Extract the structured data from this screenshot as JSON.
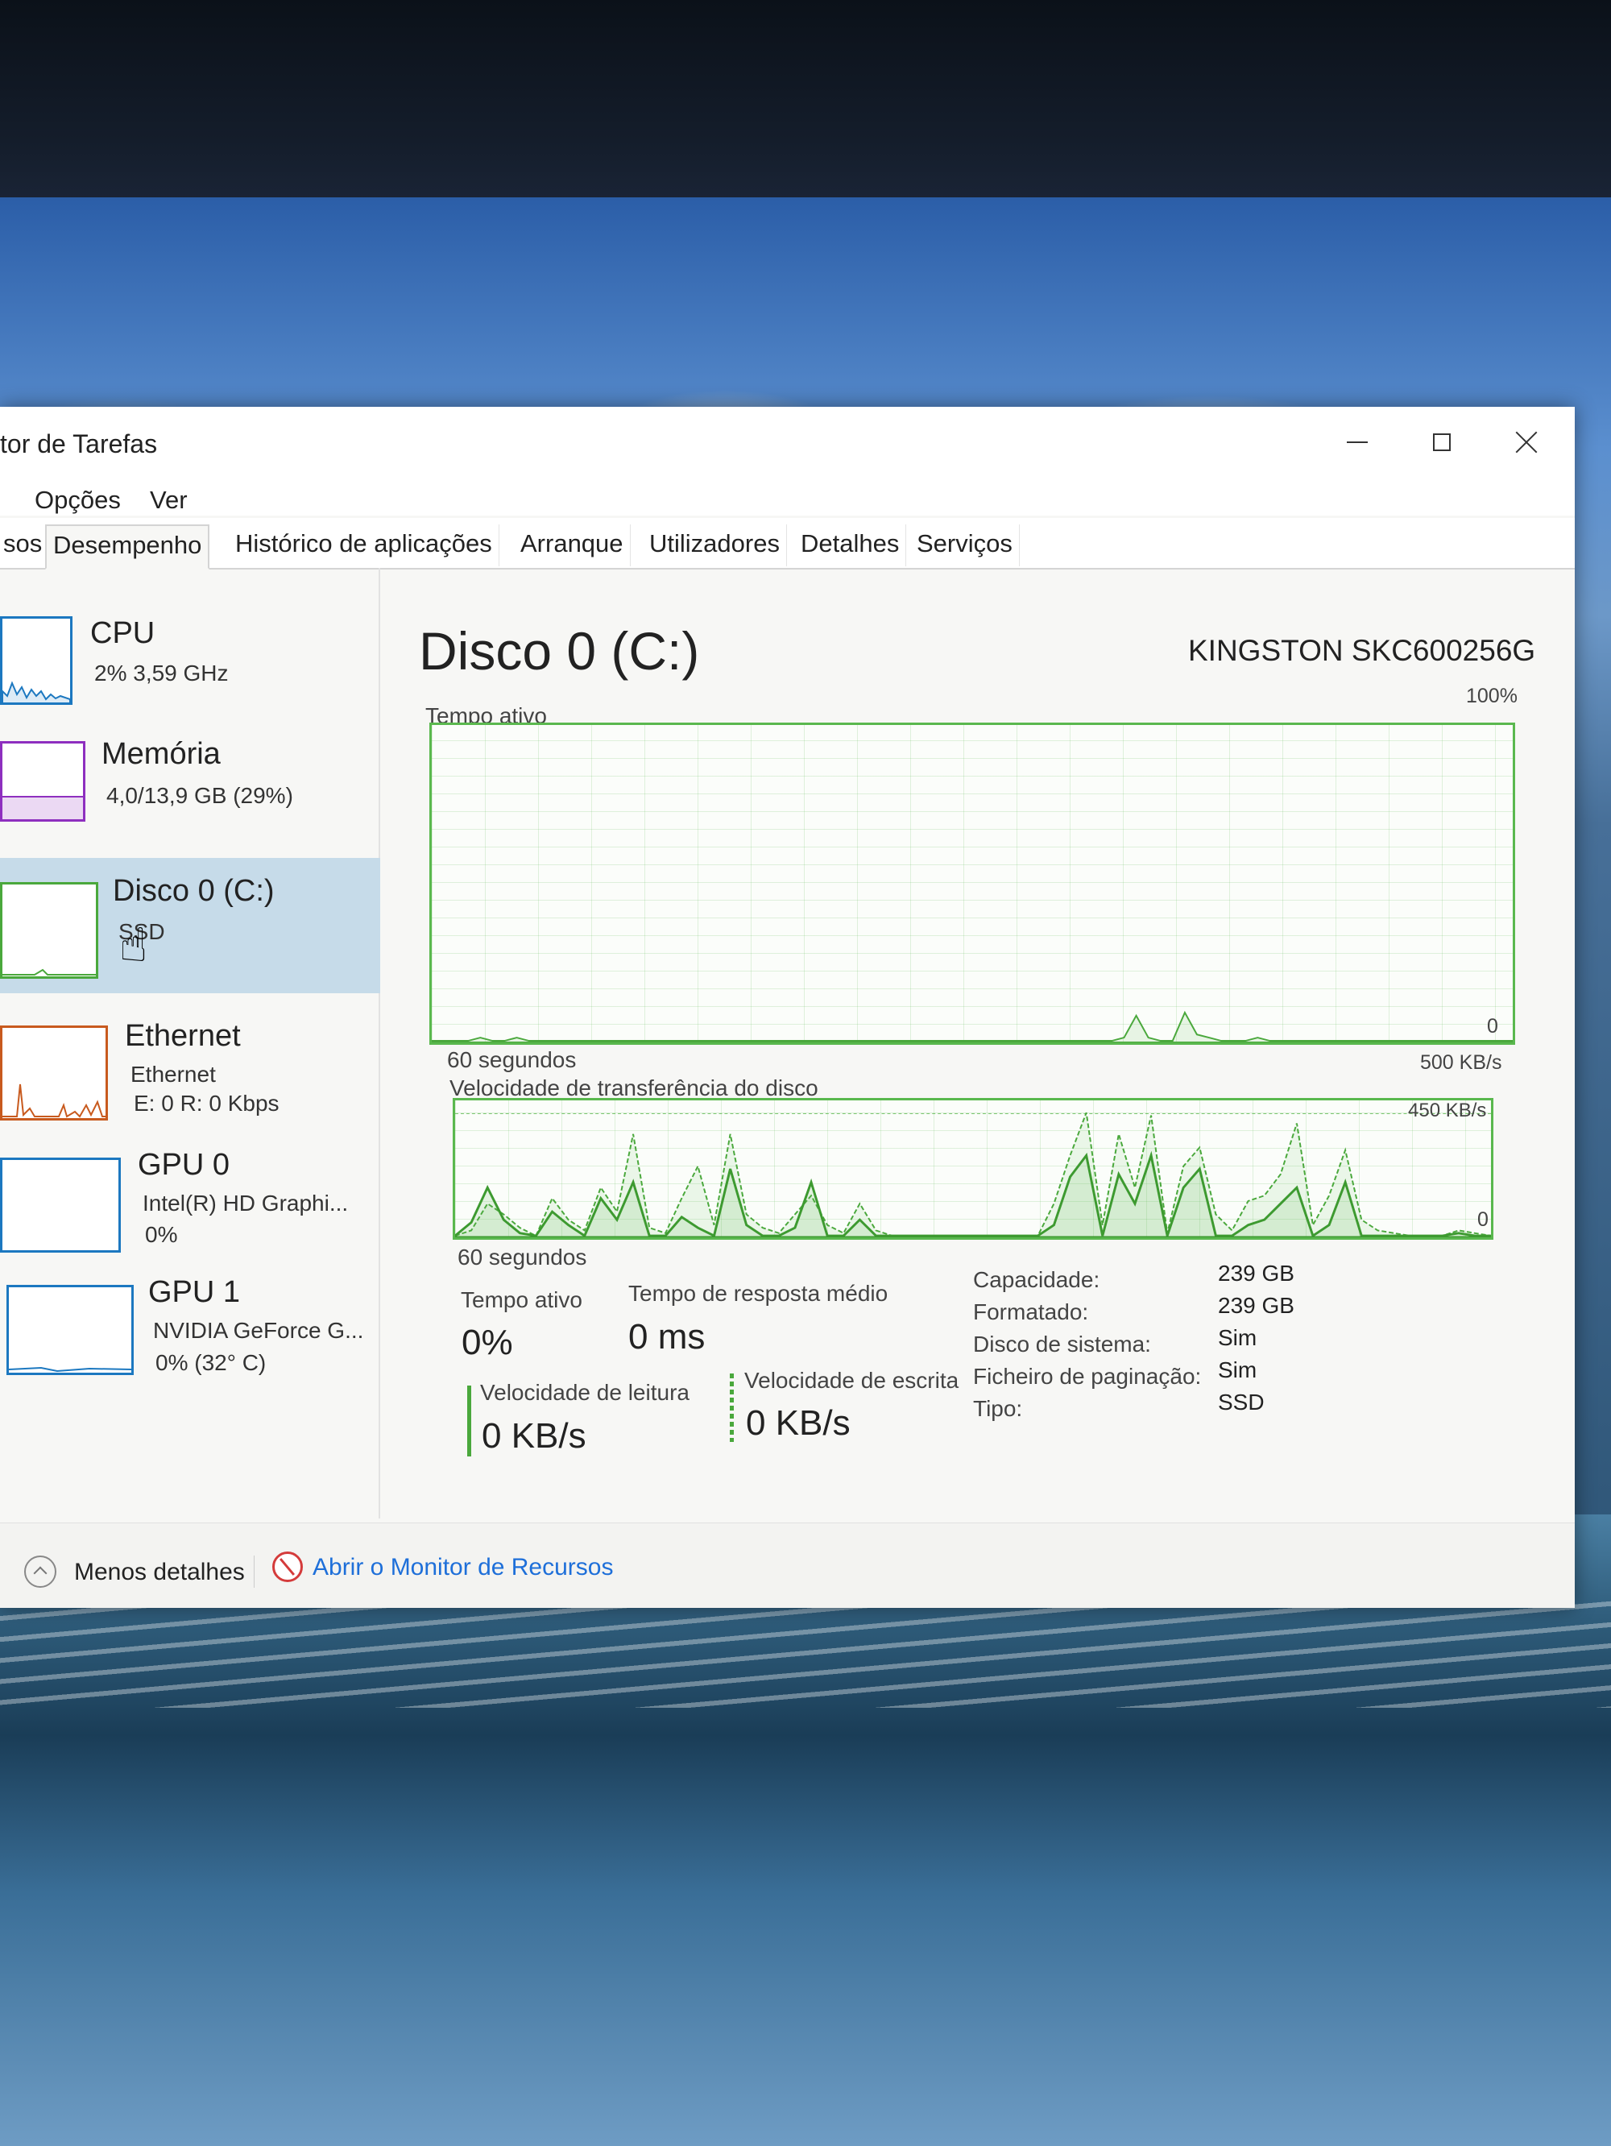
{
  "window": {
    "title": "tor de Tarefas",
    "minimize_label": "",
    "maximize_label": "",
    "close_label": ""
  },
  "menu": {
    "options": "Opções",
    "view": "Ver"
  },
  "tabs": [
    {
      "label": "sos",
      "active": false
    },
    {
      "label": "Desempenho",
      "active": true
    },
    {
      "label": "Histórico de aplicações",
      "active": false
    },
    {
      "label": "Arranque",
      "active": false
    },
    {
      "label": "Utilizadores",
      "active": false
    },
    {
      "label": "Detalhes",
      "active": false
    },
    {
      "label": "Serviços",
      "active": false
    }
  ],
  "sidebar": {
    "items": [
      {
        "title": "CPU",
        "line1": "2% 3,59 GHz",
        "line2": "",
        "color": "#1c78c0"
      },
      {
        "title": "Memória",
        "line1": "4,0/13,9 GB (29%)",
        "line2": "",
        "color": "#8e2fbf"
      },
      {
        "title": "Disco 0 (C:)",
        "line1": "SSD",
        "line2": "",
        "color": "#4aa83c",
        "selected": true
      },
      {
        "title": "Ethernet",
        "line1": "Ethernet",
        "line2": "E: 0 R: 0 Kbps",
        "color": "#c85a1e"
      },
      {
        "title": "GPU 0",
        "line1": "Intel(R) HD Graphi...",
        "line2": "0%",
        "color": "#1c78c0"
      },
      {
        "title": "GPU 1",
        "line1": "NVIDIA GeForce G...",
        "line2": "0% (32° C)",
        "color": "#1c78c0"
      }
    ]
  },
  "main": {
    "title": "Disco 0 (C:)",
    "model": "KINGSTON SKC600256G",
    "active_chart": {
      "label": "Tempo ativo",
      "max_label": "100%",
      "min_label": "0",
      "time_label": "60 segundos"
    },
    "transfer_chart": {
      "label": "Velocidade de transferência do disco",
      "max_label": "500 KB/s",
      "ref_label": "450 KB/s",
      "min_label": "0",
      "time_label": "60 segundos"
    },
    "stats": {
      "active_time_label": "Tempo ativo",
      "active_time_value": "0%",
      "response_label": "Tempo de resposta médio",
      "response_value": "0 ms",
      "read_label": "Velocidade de leitura",
      "read_value": "0 KB/s",
      "write_label": "Velocidade de escrita",
      "write_value": "0 KB/s"
    },
    "props": [
      {
        "key": "Capacidade:",
        "value": "239 GB"
      },
      {
        "key": "Formatado:",
        "value": "239 GB"
      },
      {
        "key": "Disco de sistema:",
        "value": "Sim"
      },
      {
        "key": "Ficheiro de paginação:",
        "value": "Sim"
      },
      {
        "key": "Tipo:",
        "value": "SSD"
      }
    ]
  },
  "footer": {
    "less_details": "Menos detalhes",
    "resource_monitor": "Abrir o Monitor de Recursos"
  },
  "series": {
    "active_time": [
      0,
      0,
      0,
      0,
      1,
      0,
      0,
      1,
      0,
      0,
      0,
      0,
      0,
      0,
      0,
      0,
      0,
      0,
      0,
      0,
      0,
      0,
      0,
      0,
      0,
      0,
      0,
      0,
      0,
      0,
      0,
      0,
      0,
      0,
      0,
      0,
      0,
      0,
      0,
      0,
      0,
      0,
      0,
      0,
      0,
      0,
      0,
      0,
      0,
      0,
      0,
      0,
      0,
      0,
      0,
      0,
      0,
      1,
      8,
      1,
      0,
      0,
      9,
      2,
      1,
      0,
      0,
      0,
      1,
      0,
      0,
      0,
      0,
      0,
      0,
      0,
      0,
      0,
      0,
      0,
      0,
      0,
      0,
      0,
      0,
      0,
      0,
      0,
      0,
      0
    ],
    "transfer_read": [
      0,
      50,
      180,
      60,
      10,
      0,
      90,
      40,
      0,
      140,
      60,
      200,
      0,
      0,
      70,
      30,
      0,
      250,
      40,
      0,
      0,
      30,
      200,
      0,
      0,
      60,
      0,
      0,
      0,
      0,
      0,
      0,
      0,
      0,
      0,
      0,
      0,
      40,
      220,
      300,
      0,
      230,
      120,
      300,
      0,
      180,
      250,
      0,
      0,
      40,
      60,
      120,
      180,
      0,
      40,
      200,
      0,
      0,
      0,
      0,
      0,
      0,
      10,
      0,
      0
    ],
    "transfer_write": [
      0,
      20,
      120,
      80,
      30,
      0,
      140,
      60,
      20,
      180,
      90,
      380,
      30,
      10,
      140,
      260,
      40,
      380,
      80,
      30,
      10,
      80,
      150,
      40,
      10,
      120,
      20,
      0,
      0,
      0,
      0,
      0,
      0,
      0,
      0,
      0,
      0,
      120,
      300,
      460,
      40,
      380,
      180,
      450,
      10,
      260,
      330,
      80,
      20,
      130,
      150,
      230,
      420,
      40,
      150,
      320,
      60,
      20,
      10,
      0,
      0,
      0,
      20,
      10,
      0
    ]
  }
}
